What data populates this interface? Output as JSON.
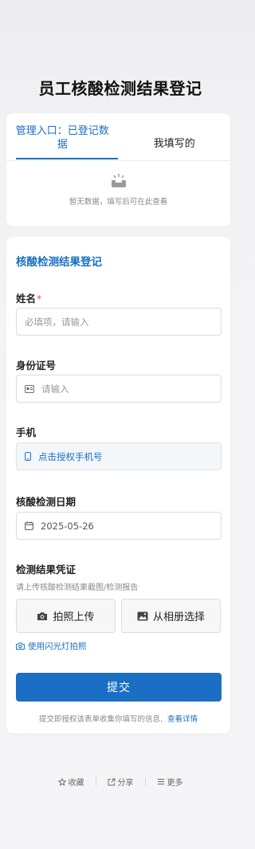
{
  "page": {
    "title": "员工核酸检测结果登记"
  },
  "tabs": [
    {
      "label": "管理入口：已登记数据"
    },
    {
      "label": "我填写的"
    }
  ],
  "empty_state": {
    "text": "暂无数据，填写后可在此查看"
  },
  "form": {
    "title": "核酸检测结果登记",
    "name": {
      "label": "姓名",
      "required_mark": "*",
      "placeholder": "必填项，请输入"
    },
    "id_number": {
      "label": "身份证号",
      "placeholder": "请输入"
    },
    "phone": {
      "label": "手机",
      "button_text": "点击授权手机号"
    },
    "test_date": {
      "label": "核酸检测日期",
      "value": "2025-05-26"
    },
    "proof": {
      "label": "检测结果凭证",
      "hint": "请上传核酸检测结果截图/检测报告",
      "camera_button": "拍照上传",
      "album_button": "从相册选择",
      "flash_link": "使用闪光灯拍照"
    },
    "submit_label": "提交",
    "consent_text": "提交即授权该表单收集你填写的信息,",
    "consent_link": "查看详情"
  },
  "footer": [
    {
      "label": "收藏",
      "icon": "star-icon"
    },
    {
      "label": "分享",
      "icon": "share-icon"
    },
    {
      "label": "更多",
      "icon": "menu-icon"
    }
  ],
  "colors": {
    "accent": "#1a6fc4",
    "required": "#e34d4d"
  }
}
